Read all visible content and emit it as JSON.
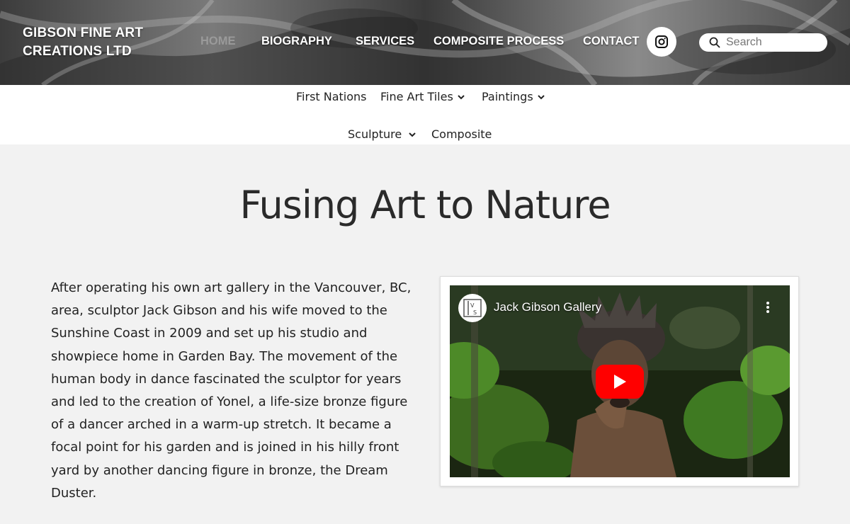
{
  "header": {
    "brand": "GIBSON FINE ART CREATIONS LTD",
    "nav": [
      {
        "label": "HOME",
        "active": true
      },
      {
        "label": "BIOGRAPHY",
        "active": false
      },
      {
        "label": "SERVICES",
        "active": false
      },
      {
        "label": "COMPOSITE PROCESS",
        "active": false
      },
      {
        "label": "CONTACT",
        "active": false
      }
    ],
    "social_icon": "instagram-icon",
    "search": {
      "placeholder": "Search",
      "value": "",
      "icon": "search-icon"
    }
  },
  "subnav": {
    "items": [
      {
        "label": "First Nations",
        "dropdown": false
      },
      {
        "label": "Fine Art Tiles",
        "dropdown": true
      },
      {
        "label": "Paintings",
        "dropdown": true
      },
      {
        "label": "Sculpture",
        "dropdown": true
      },
      {
        "label": "Composite",
        "dropdown": false
      }
    ]
  },
  "main": {
    "title": "Fusing Art to Nature",
    "paragraph": "After operating his own art gallery in the Vancouver, BC, area, sculptor Jack Gibson and his wife moved to the Sunshine Coast in 2009 and set up his studio and showpiece home in Garden Bay. The movement of the human body in dance fascinated the sculptor for years and led to the creation of Yonel, a life-size bronze figure of a dancer arched in a warm-up stretch. It became a focal point for his garden and is joined in his hilly front yard by another dancing figure in bronze, the Dream Duster.",
    "video": {
      "channel_title": "Jack Gibson Gallery",
      "channel_logo_text": "VS",
      "play_color": "#ff0000"
    }
  },
  "colors": {
    "page_bg": "#f2f2f2",
    "nav_active": "#9a9a9a",
    "text": "#222222"
  }
}
